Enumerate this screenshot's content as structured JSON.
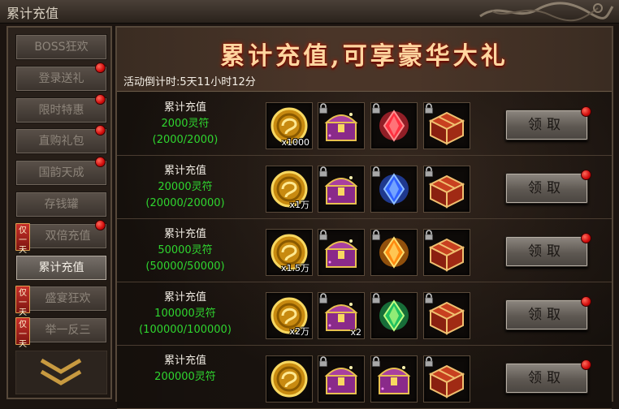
{
  "window": {
    "title": "累计充值"
  },
  "sidebar": {
    "items": [
      {
        "label": "BOSS狂欢",
        "dot": false,
        "tag": "",
        "active": false
      },
      {
        "label": "登录送礼",
        "dot": true,
        "tag": "",
        "active": false
      },
      {
        "label": "限时特惠",
        "dot": true,
        "tag": "",
        "active": false
      },
      {
        "label": "直购礼包",
        "dot": true,
        "tag": "",
        "active": false
      },
      {
        "label": "国韵天成",
        "dot": true,
        "tag": "",
        "active": false
      },
      {
        "label": "存钱罐",
        "dot": false,
        "tag": "",
        "active": false
      },
      {
        "label": "双倍充值",
        "dot": true,
        "tag": "仅一天",
        "active": false
      },
      {
        "label": "累计充值",
        "dot": false,
        "tag": "",
        "active": true
      },
      {
        "label": "盛宴狂欢",
        "dot": false,
        "tag": "仅一天",
        "active": false
      },
      {
        "label": "举一反三",
        "dot": false,
        "tag": "仅一天",
        "active": false
      }
    ]
  },
  "banner": {
    "heading": "累计充值,可享豪华大礼",
    "countdown": "活动倒计时:5天11小时12分"
  },
  "claim_label": "领取",
  "rows": [
    {
      "line1": "累计充值",
      "line2": "2000灵符",
      "line3": "(2000/2000)",
      "items": [
        {
          "icon": "gold-coin-icon",
          "qty": "x1000",
          "locked": false
        },
        {
          "icon": "treasure-chest-icon",
          "qty": "",
          "locked": true
        },
        {
          "icon": "red-gem-icon",
          "qty": "",
          "locked": true
        },
        {
          "icon": "gift-box-icon",
          "qty": "",
          "locked": true
        }
      ]
    },
    {
      "line1": "累计充值",
      "line2": "20000灵符",
      "line3": "(20000/20000)",
      "items": [
        {
          "icon": "gold-coin-icon",
          "qty": "x1万",
          "locked": false
        },
        {
          "icon": "treasure-chest-icon",
          "qty": "",
          "locked": true
        },
        {
          "icon": "blue-gem-icon",
          "qty": "",
          "locked": true
        },
        {
          "icon": "gift-box-icon",
          "qty": "",
          "locked": true
        }
      ]
    },
    {
      "line1": "累计充值",
      "line2": "50000灵符",
      "line3": "(50000/50000)",
      "items": [
        {
          "icon": "gold-coin-icon",
          "qty": "x1.5万",
          "locked": false
        },
        {
          "icon": "treasure-chest-icon",
          "qty": "",
          "locked": true
        },
        {
          "icon": "fire-gem-icon",
          "qty": "",
          "locked": true
        },
        {
          "icon": "gift-box-icon",
          "qty": "",
          "locked": true
        }
      ]
    },
    {
      "line1": "累计充值",
      "line2": "100000灵符",
      "line3": "(100000/100000)",
      "items": [
        {
          "icon": "gold-coin-icon",
          "qty": "x2万",
          "locked": false
        },
        {
          "icon": "treasure-chest-icon",
          "qty": "x2",
          "locked": true
        },
        {
          "icon": "green-gem-icon",
          "qty": "",
          "locked": true
        },
        {
          "icon": "red-chest-icon",
          "qty": "",
          "locked": true
        }
      ]
    },
    {
      "line1": "累计充值",
      "line2": "200000灵符",
      "line3": "",
      "items": [
        {
          "icon": "gold-coin-icon",
          "qty": "",
          "locked": false
        },
        {
          "icon": "treasure-chest-icon",
          "qty": "",
          "locked": true
        },
        {
          "icon": "treasure-chest-icon",
          "qty": "",
          "locked": true
        },
        {
          "icon": "red-chest-icon",
          "qty": "",
          "locked": true
        }
      ]
    }
  ]
}
